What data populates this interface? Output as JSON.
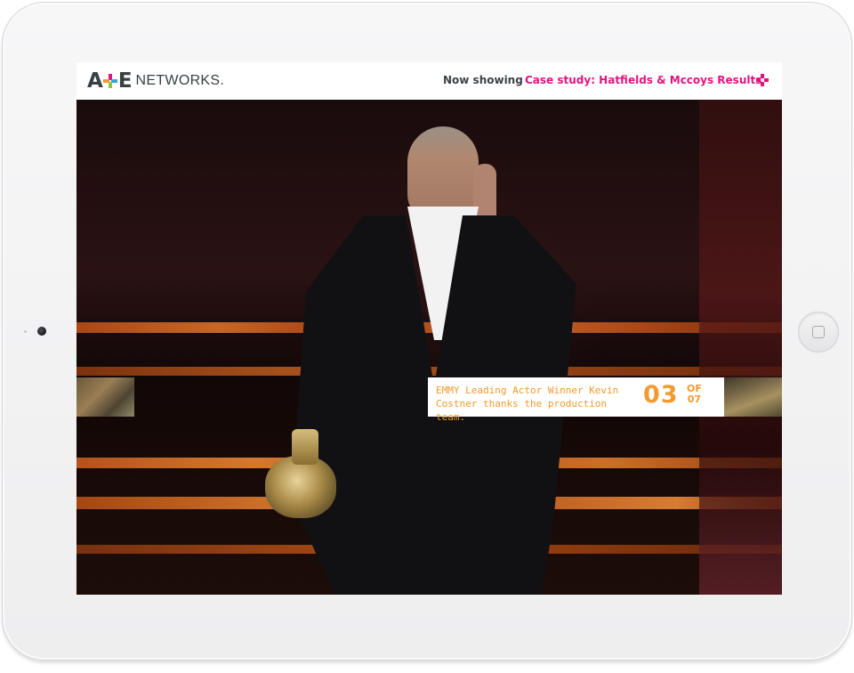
{
  "app": {
    "logo_text_a": "A",
    "logo_text_e": "E",
    "logo_text_networks": "NETWORKS."
  },
  "header": {
    "now_showing_label": "Now showing",
    "case_study_link": "Case study: Hatfields & Mccoys Results",
    "menu_icon": "plus-icon"
  },
  "slide": {
    "caption": "EMMY Leading Actor Winner Kevin Costner thanks the production team.",
    "current": "03",
    "of_label": "OF",
    "total": "07"
  },
  "colors": {
    "accent_pink": "#e2157f",
    "accent_orange": "#f29a2e",
    "logo_gray": "#3a3f44"
  }
}
